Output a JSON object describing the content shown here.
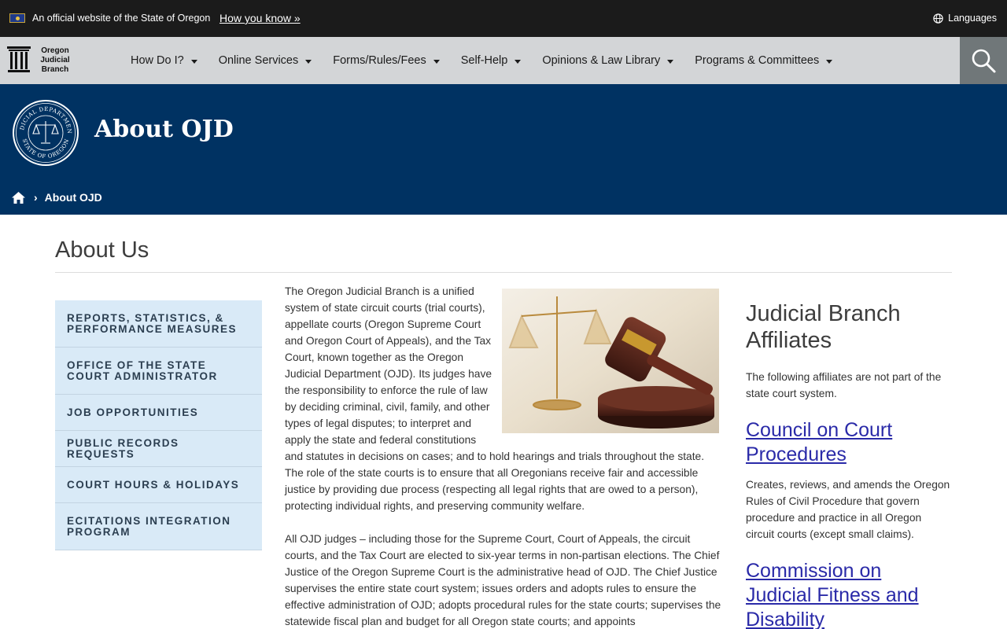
{
  "banner": {
    "official_text": "An official website of the State of Oregon",
    "how_link": "How you know »",
    "languages": "Languages"
  },
  "logo": {
    "line1": "Oregon",
    "line2": "Judicial",
    "line3": "Branch"
  },
  "nav": {
    "items": [
      {
        "label": "How Do I?"
      },
      {
        "label": "Online Services"
      },
      {
        "label": "Forms/Rules/Fees"
      },
      {
        "label": "Self-Help"
      },
      {
        "label": "Opinions & Law Library"
      },
      {
        "label": "Programs & Committees"
      }
    ]
  },
  "hero": {
    "title": "About OJD",
    "seal_top": "JUDICIAL DEPARTMENT",
    "seal_bottom": "STATE OF OREGON",
    "breadcrumb_current": "About OJD"
  },
  "page": {
    "title": "About Us"
  },
  "sidebar": {
    "items": [
      {
        "label": "REPORTS, STATISTICS, & PERFORMANCE MEASURES"
      },
      {
        "label": "OFFICE OF THE STATE COURT ADMINISTRATOR"
      },
      {
        "label": "JOB OPPORTUNITIES"
      },
      {
        "label": "PUBLIC RECORDS REQUESTS"
      },
      {
        "label": "COURT HOURS & HOLIDAYS"
      },
      {
        "label": "ECITATIONS INTEGRATION PROGRAM"
      }
    ]
  },
  "article": {
    "p1": "The Oregon Judicial Branch is a unified system of state circuit courts (trial courts), appellate courts (Oregon Supreme Court and Oregon Court of Appeals), and the Tax Court, known together as the Oregon Judicial Department (OJD). Its judges have the responsibility to enforce the rule of law by deciding criminal, civil, family, and other types of legal disputes; to interpret and apply the state and federal constitutions and statutes in decisions on cases; and to hold hearings and trials throughout the state. The role of the state courts is to ensure that all Oregonians receive fair and accessible justice by providing due process (respecting all legal rights that are owed to a person), protecting individual rights, and preserving community welfare.",
    "p2": "All OJD judges – including those for the Supreme Court, Court of Appeals, the circuit courts, and the Tax Court are elected to six-year terms in non-partisan elections. The Chief Justice of the Oregon Supreme Court is the administrative head of OJD. The Chief Justice supervises the entire state court system; issues orders and adopts rules to ensure the effective administration of OJD; adopts procedural rules for the state courts; supervises the statewide fiscal plan and budget for all Oregon state courts; and appoints"
  },
  "affiliates": {
    "heading": "Judicial Branch Affiliates",
    "note": "The following affiliates are not part of the state court system.",
    "items": [
      {
        "title": "Council on Court Procedures",
        "desc": "Creates, reviews, and amends the Oregon Rules of Civil Procedure that govern procedure and practice in all Oregon circuit courts (except small claims)."
      },
      {
        "title": "Commission on Judicial Fitness and Disability",
        "desc": ""
      }
    ]
  },
  "colors": {
    "banner_bg": "#1b1b1b",
    "nav_bg": "#d3d5d7",
    "hero_bg": "#003262",
    "sidebar_bg": "#d9eaf7",
    "link": "#2a2aa8"
  }
}
